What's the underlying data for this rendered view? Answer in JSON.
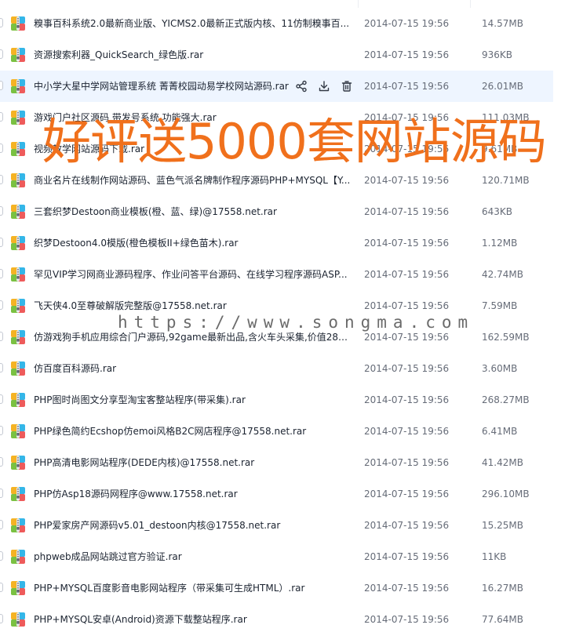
{
  "files": [
    {
      "name": "糗事百科系统2.0最新商业版、YICMS2.0最新正式版内核、11仿制糗事百...",
      "date": "2014-07-15 19:56",
      "size": "14.57MB"
    },
    {
      "name": "资源搜索利器_QuickSearch_绿色版.rar",
      "date": "2014-07-15 19:56",
      "size": "936KB"
    },
    {
      "name": "中小学大星中学网站管理系统 菁菁校园动易学校网站源码.rar",
      "date": "2014-07-15 19:56",
      "size": "26.01MB",
      "hovered": true
    },
    {
      "name": "游戏门户社区源码 带发号系统 功能强大.rar",
      "date": "2014-07-15 19:56",
      "size": "111.03MB"
    },
    {
      "name": "视频教学网站源码下载.rar",
      "date": "2014-07-15 19:56",
      "size": "9.61MB"
    },
    {
      "name": "商业名片在线制作网站源码、蓝色气派名牌制作程序源码PHP+MYSQL【Y...",
      "date": "2014-07-15 19:56",
      "size": "120.71MB"
    },
    {
      "name": "三套织梦Destoon商业模板(橙、蓝、绿)@17558.net.rar",
      "date": "2014-07-15 19:56",
      "size": "643KB"
    },
    {
      "name": "织梦Destoon4.0模版(橙色模板II+绿色苗木).rar",
      "date": "2014-07-15 19:56",
      "size": "1.12MB"
    },
    {
      "name": "罕见VIP学习网商业源码程序、作业问答平台源码、在线学习程序源码ASP...",
      "date": "2014-07-15 19:56",
      "size": "42.74MB"
    },
    {
      "name": "飞天侠4.0至尊破解版完整版@17558.net.rar",
      "date": "2014-07-15 19:56",
      "size": "7.59MB"
    },
    {
      "name": "仿游戏狗手机应用综合门户源码,92game最新出品,含火车头采集,价值280...",
      "date": "2014-07-15 19:56",
      "size": "162.59MB"
    },
    {
      "name": "仿百度百科源码.rar",
      "date": "2014-07-15 19:56",
      "size": "3.60MB"
    },
    {
      "name": "PHP图时尚图文分享型淘宝客整站程序(带采集).rar",
      "date": "2014-07-15 19:56",
      "size": "268.27MB"
    },
    {
      "name": "PHP绿色简约Ecshop仿emoi风格B2C网店程序@17558.net.rar",
      "date": "2014-07-15 19:56",
      "size": "6.41MB"
    },
    {
      "name": "PHP高清电影网站程序(DEDE内核)@17558.net.rar",
      "date": "2014-07-15 19:56",
      "size": "41.42MB"
    },
    {
      "name": "PHP仿Asp18源码网程序@www.17558.net.rar",
      "date": "2014-07-15 19:56",
      "size": "296.10MB"
    },
    {
      "name": "PHP爱家房产网源码v5.01_destoon内核@17558.net.rar",
      "date": "2014-07-15 19:56",
      "size": "15.25MB"
    },
    {
      "name": "phpweb成品网站跳过官方验证.rar",
      "date": "2014-07-15 19:56",
      "size": "11KB"
    },
    {
      "name": "PHP+MYSQL百度影音电影网站程序（带采集可生成HTML）.rar",
      "date": "2014-07-15 19:56",
      "size": "16.27MB"
    },
    {
      "name": "PHP+MYSQL安卓(Android)资源下载整站程序.rar",
      "date": "2014-07-15 19:56",
      "size": "77.64MB"
    }
  ],
  "icons": {
    "file": "archive-file-icon",
    "share": "share-icon",
    "download": "download-icon",
    "delete": "trash-icon"
  },
  "colors": {
    "banner": "#f0701c",
    "hover_row": "#eef5ff"
  },
  "overlay": {
    "banner_text": "好评送5000套网站源码",
    "watermark_text": "https://www.songma.com"
  }
}
